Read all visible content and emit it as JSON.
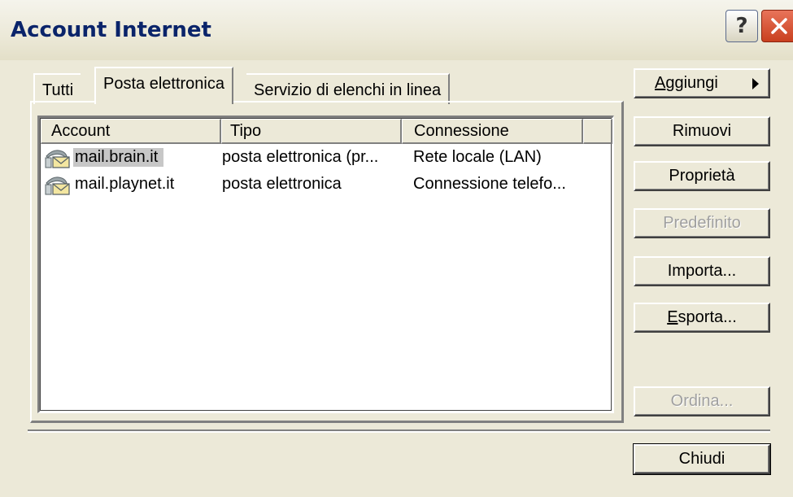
{
  "window": {
    "title": "Account Internet",
    "help_label": "?",
    "close_icon": "close-x-icon"
  },
  "tabs": [
    {
      "label": "Tutti",
      "selected": false
    },
    {
      "label": "Posta elettronica",
      "selected": true
    },
    {
      "label": "Servizio di elenchi in linea",
      "selected": false
    }
  ],
  "list": {
    "columns": [
      "Account",
      "Tipo",
      "Connessione"
    ],
    "rows": [
      {
        "account": "mail.brain.it",
        "tipo": "posta elettronica (pr...",
        "connessione": "Rete locale (LAN)",
        "selected": true,
        "icon": "mail-account-icon"
      },
      {
        "account": "mail.playnet.it",
        "tipo": "posta elettronica",
        "connessione": "Connessione telefo...",
        "selected": false,
        "icon": "mail-account-icon"
      }
    ]
  },
  "buttons": {
    "aggiungi_first": "A",
    "aggiungi_rest": "ggiungi",
    "rimuovi": "Rimuovi",
    "proprieta": "Proprietà",
    "predefinito": "Predefinito",
    "importa": "Importa...",
    "esporta_first": "E",
    "esporta_rest": "sporta...",
    "ordina": "Ordina...",
    "chiudi": "Chiudi"
  },
  "colors": {
    "face": "#ece9d8",
    "title_text": "#0a246a",
    "close_red": "#c9401f",
    "disabled_text": "#a0a0a0"
  }
}
